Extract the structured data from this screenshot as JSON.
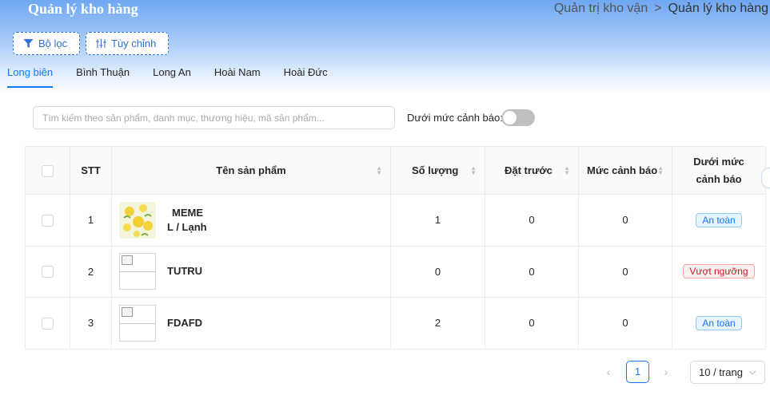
{
  "header": {
    "title": "Quản lý kho hàng",
    "breadcrumb": [
      "Quản trị kho vận",
      "Quản lý kho hàng"
    ],
    "breadcrumb_separator": ">"
  },
  "toolbar": {
    "filter_label": "Bộ lọc",
    "customize_label": "Tùy chỉnh"
  },
  "tabs": [
    {
      "label": "Long biên",
      "active": true
    },
    {
      "label": "Bình Thuận",
      "active": false
    },
    {
      "label": "Long An",
      "active": false
    },
    {
      "label": "Hoài Nam",
      "active": false
    },
    {
      "label": "Hoài Đức",
      "active": false
    }
  ],
  "search": {
    "placeholder": "Tìm kiếm theo sản phẩm, danh mục, thương hiệu, mã sản phẩm...",
    "value": ""
  },
  "warning_toggle": {
    "label": "Dưới mức cảnh báo:",
    "on": false
  },
  "table": {
    "columns": [
      "STT",
      "Tên sản phẩm",
      "Số lượng",
      "Đặt trước",
      "Mức cảnh báo",
      "Dưới mức cảnh báo"
    ],
    "rows": [
      {
        "stt": "1",
        "name": "MEME",
        "variant": "L / Lạnh",
        "quantity": "1",
        "reserved": "0",
        "warning_level": "0",
        "status": "An toàn",
        "status_type": "safe"
      },
      {
        "stt": "2",
        "name": "TUTRU",
        "variant": "",
        "quantity": "0",
        "reserved": "0",
        "warning_level": "0",
        "status": "Vượt ngưỡng",
        "status_type": "over"
      },
      {
        "stt": "3",
        "name": "FDAFD",
        "variant": "",
        "quantity": "2",
        "reserved": "0",
        "warning_level": "0",
        "status": "An toàn",
        "status_type": "safe"
      }
    ]
  },
  "pagination": {
    "current_page": "1",
    "page_size": "10 / trang"
  },
  "colors": {
    "primary": "#1677ff",
    "safe": "#1677ff",
    "over": "#cf1322"
  }
}
